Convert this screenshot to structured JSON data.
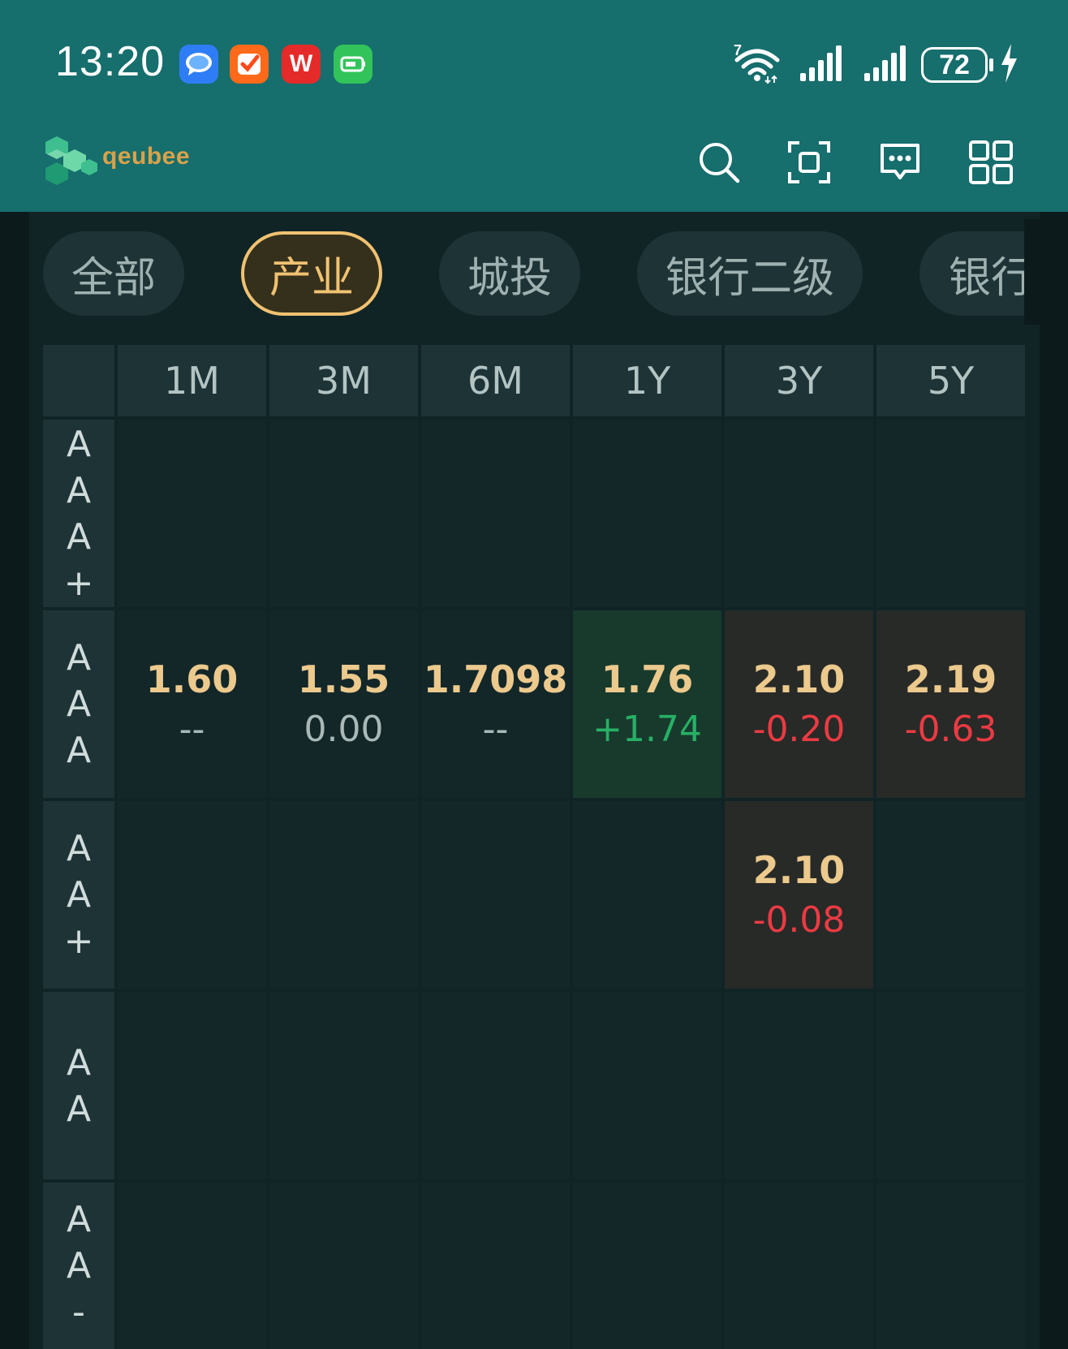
{
  "status_bar": {
    "time": "13:20",
    "apps": [
      "messages-icon",
      "tasks-icon",
      "wps-icon",
      "battery-app-icon"
    ],
    "wifi_badge": "7",
    "battery": "72"
  },
  "app_bar": {
    "logo_text": "qeubee",
    "actions": [
      "search-icon",
      "scan-icon",
      "message-icon",
      "grid-menu-icon"
    ]
  },
  "tabs": [
    {
      "label": "全部",
      "active": false
    },
    {
      "label": "产业",
      "active": true
    },
    {
      "label": "城投",
      "active": false
    },
    {
      "label": "银行二级",
      "active": false
    },
    {
      "label": "银行",
      "active": false
    }
  ],
  "table": {
    "columns": [
      "1M",
      "3M",
      "6M",
      "1Y",
      "3Y",
      "5Y"
    ],
    "rows": [
      {
        "rating": "AAA+",
        "cells": [
          null,
          null,
          null,
          null,
          null,
          null
        ]
      },
      {
        "rating": "AAA",
        "cells": [
          {
            "rate": "1.60",
            "change": "--",
            "trend": "flat"
          },
          {
            "rate": "1.55",
            "change": "0.00",
            "trend": "flat"
          },
          {
            "rate": "1.7098",
            "change": "--",
            "trend": "flat"
          },
          {
            "rate": "1.76",
            "change": "+1.74",
            "trend": "up"
          },
          {
            "rate": "2.10",
            "change": "-0.20",
            "trend": "down"
          },
          {
            "rate": "2.19",
            "change": "-0.63",
            "trend": "down"
          }
        ]
      },
      {
        "rating": "AA+",
        "cells": [
          null,
          null,
          null,
          null,
          {
            "rate": "2.10",
            "change": "-0.08",
            "trend": "down"
          },
          null
        ]
      },
      {
        "rating": "AA",
        "cells": [
          null,
          null,
          null,
          null,
          null,
          null
        ]
      },
      {
        "rating": "AA-",
        "cells": [
          null,
          null,
          null,
          null,
          null,
          null
        ]
      }
    ]
  },
  "colors": {
    "header_bg": "#166e6d",
    "accent": "#f0c271",
    "up": "#27b065",
    "down": "#ec3a43"
  }
}
